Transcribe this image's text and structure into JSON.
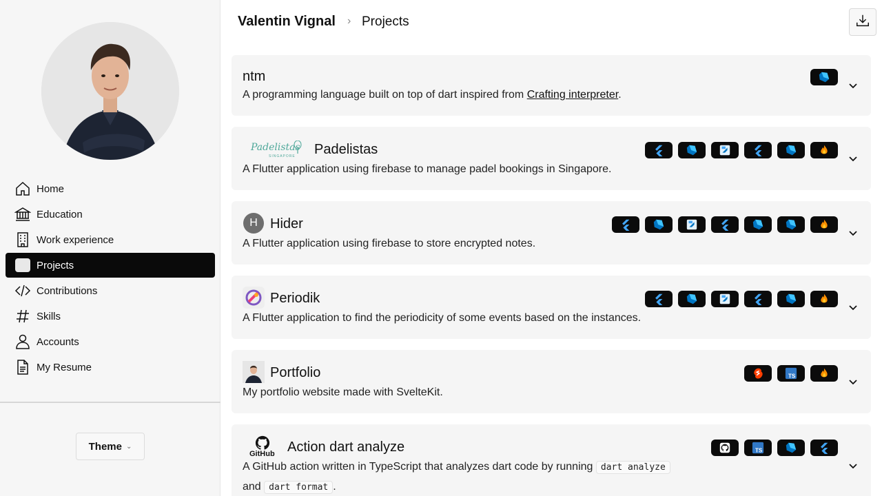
{
  "sidebar": {
    "nav": [
      {
        "label": "Home",
        "icon": "home-icon"
      },
      {
        "label": "Education",
        "icon": "bank-icon"
      },
      {
        "label": "Work experience",
        "icon": "building-icon"
      },
      {
        "label": "Projects",
        "icon": "projects-icon",
        "active": true
      },
      {
        "label": "Contributions",
        "icon": "code-icon"
      },
      {
        "label": "Skills",
        "icon": "hash-icon"
      },
      {
        "label": "Accounts",
        "icon": "user-icon"
      },
      {
        "label": "My Resume",
        "icon": "document-icon"
      }
    ],
    "theme_label": "Theme"
  },
  "header": {
    "breadcrumb_root": "Valentin Vignal",
    "breadcrumb_separator": "›",
    "breadcrumb_current": "Projects"
  },
  "projects": [
    {
      "title": "ntm",
      "description_before": "A programming language built on top of dart inspired from ",
      "link_text": "Crafting interpreter",
      "description_after": ".",
      "tech": [
        "dart"
      ]
    },
    {
      "title": "Padelistas",
      "logo_text": "Padelistas",
      "logo_subtext": "SINGAPORE",
      "description": "A Flutter application using firebase to manage padel bookings in Singapore.",
      "tech": [
        "flutter",
        "dart",
        "flutter-web",
        "flutter",
        "dart",
        "firebase"
      ]
    },
    {
      "title": "Hider",
      "avatar_letter": "H",
      "description": "A Flutter application using firebase to store encrypted notes.",
      "tech": [
        "flutter",
        "dart",
        "flutter-web",
        "flutter",
        "dart",
        "dart",
        "firebase"
      ]
    },
    {
      "title": "Periodik",
      "description": "A Flutter application to find the periodicity of some events based on the instances.",
      "tech": [
        "flutter",
        "dart",
        "flutter-web",
        "flutter",
        "dart",
        "firebase"
      ]
    },
    {
      "title": "Portfolio",
      "description": "My portfolio website made with SvelteKit.",
      "tech": [
        "svelte",
        "typescript",
        "firebase"
      ]
    },
    {
      "title": "Action dart analyze",
      "logo_text": "GitHub",
      "description_before": "A GitHub action written in TypeScript that analyzes dart code by running ",
      "code_1": "dart analyze",
      "description_mid": "and ",
      "code_2": "dart format",
      "description_after": ".",
      "tech": [
        "github",
        "typescript",
        "dart",
        "flutter"
      ]
    }
  ],
  "ts_badge_text": "TS",
  "colors": {
    "sidebar_bg": "#f6f6f6",
    "active_nav_bg": "#0a0a0a",
    "card_bg": "#f5f5f5",
    "badge_bg": "#0b0b0b",
    "flutter_blue": "#42a5f5",
    "dart_blue": "#0175c2",
    "firebase_orange": "#ff8f00",
    "svelte_red": "#ff3e00",
    "typescript_blue": "#3178c6"
  }
}
